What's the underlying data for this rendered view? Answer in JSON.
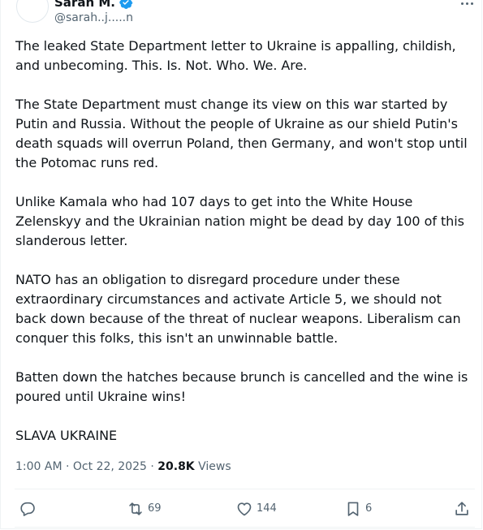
{
  "author": {
    "display_name": "Sarah M.",
    "handle": "@sarah..j.....n",
    "verified_icon": "verified-badge-icon"
  },
  "more_icon": "ellipsis-icon",
  "tweet": {
    "paragraphs": [
      "The leaked State Department letter to Ukraine is appalling, childish, and unbecoming. This. Is. Not. Who. We. Are.",
      "The State Department must change its view on this war started by Putin and Russia. Without the people of Ukraine as our shield Putin's death squads will overrun Poland, then Germany, and won't stop until the Potomac runs red.",
      "Unlike Kamala who had 107 days to get into the White House Zelenskyy and the Ukrainian nation might be dead by day 100 of this slanderous letter.",
      "NATO has an obligation to disregard procedure under these extraordinary circumstances and activate Article 5, we should not back down because of the threat of nuclear weapons. Liberalism can conquer this folks, this isn't an unwinnable battle.",
      "Batten down the hatches because brunch is cancelled and the wine is poured until Ukraine wins!"
    ],
    "closing": "SLAVA UKRAINE",
    "closing_emoji": "ukraine-flag-icon"
  },
  "meta": {
    "time": "1:00 AM",
    "separator": "·",
    "date": "Oct 22, 2025",
    "views_count": "20.8K",
    "views_label": "Views"
  },
  "actions": {
    "reply": {
      "icon": "reply-icon",
      "count": ""
    },
    "repost": {
      "icon": "repost-icon",
      "count": "69"
    },
    "like": {
      "icon": "heart-icon",
      "count": "144"
    },
    "bookmark": {
      "icon": "bookmark-icon",
      "count": "6"
    },
    "share": {
      "icon": "share-icon",
      "count": ""
    }
  },
  "colors": {
    "text": "#0f1419",
    "secondary": "#536471",
    "verified": "#1d9bf0",
    "divider": "#eff3f4",
    "flag_blue": "#2f6ed8",
    "flag_yellow": "#f5c823"
  }
}
